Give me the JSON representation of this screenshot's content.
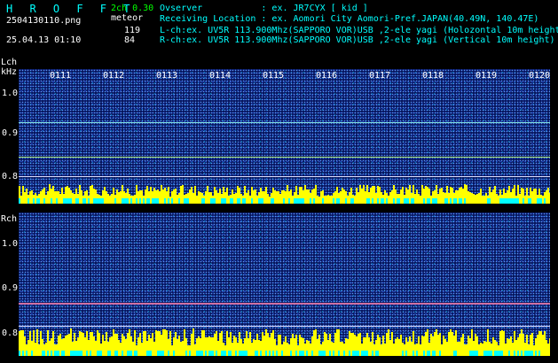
{
  "header": {
    "app_title": "H R O F F T",
    "version": "2ch 0.30",
    "filename": "2504130110.png",
    "meteor_label": "meteor",
    "lch_count": "119",
    "rch_count": "84",
    "datetime": "25.04.13 01:10",
    "observer_line": "Ovserver           : ex. JR7CYX [ kid ]",
    "location_line": "Receiving Location : ex. Aomori City Aomori-Pref.JAPAN(40.49N, 140.47E)",
    "lch_line": "L-ch:ex. UV5R 113.900Mhz(SAPPORO VOR)USB ,2-ele yagi (Holozontal 10m height)",
    "rch_line": "R-ch:ex. UV5R 113.900Mhz(SAPPORO VOR)USB ,2-ele yagi (Vertical 10m height)"
  },
  "lch": {
    "label": "Lch",
    "unit": "kHz",
    "y_ticks": [
      "1.0",
      "0.9",
      "0.8"
    ],
    "time_ticks": [
      "0111",
      "0112",
      "0113",
      "0114",
      "0115",
      "0116",
      "0117",
      "0118",
      "0119",
      "0120"
    ]
  },
  "rch": {
    "label": "Rch",
    "y_ticks": [
      "1.0",
      "0.9",
      "0.8"
    ]
  },
  "colors": {
    "background": "#000000",
    "panel": "#06155c",
    "header_cyan": "#00ffff",
    "bars_yellow": "#ffff00",
    "bars_cyan": "#00ffff"
  }
}
